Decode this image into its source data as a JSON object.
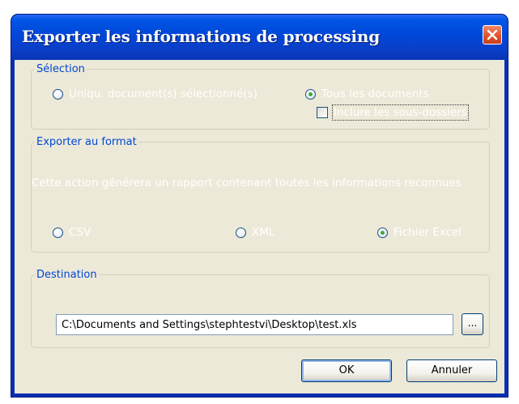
{
  "window": {
    "title": "Exporter les informations de processing"
  },
  "selection": {
    "legend": "Sélection",
    "option_selected_docs": "Uniqu. document(s) sélectionné(s)",
    "option_all_docs": "Tous les documents",
    "include_subfolders": "Inclure les sous-dossiers",
    "selected": "all_docs"
  },
  "format": {
    "legend": "Exporter au format",
    "description": "Cette action générera un rapport contenant toutes les informations reconnues",
    "option_csv": "CSV",
    "option_xml": "XML",
    "option_excel": "Fichier Excel",
    "selected": "excel"
  },
  "destination": {
    "legend": "Destination",
    "path_value": "C:\\Documents and Settings\\stephtestvi\\Desktop\\test.xls",
    "browse_label": "..."
  },
  "buttons": {
    "ok_label": "OK",
    "cancel_label": "Annuler"
  },
  "colors": {
    "titlebar": "#0047d8",
    "dialog_bg": "#ece9d8",
    "legend_text": "#0046d5",
    "radio_checked": "#3fa83a"
  },
  "icons": {
    "close": "close-icon"
  }
}
